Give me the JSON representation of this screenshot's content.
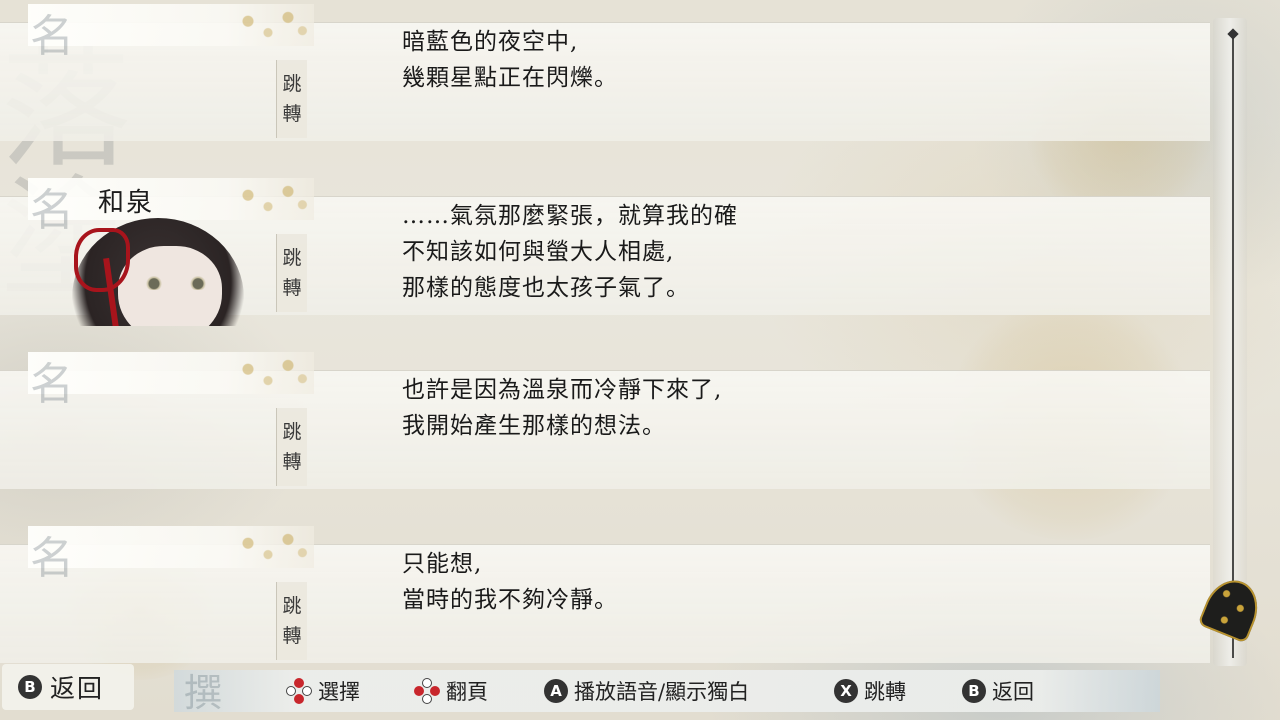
{
  "log_entries": [
    {
      "speaker": "",
      "name_ghost": "名",
      "jump_label": [
        "跳",
        "轉"
      ],
      "lines": [
        "暗藍色的夜空中,",
        "幾顆星點正在閃爍。"
      ]
    },
    {
      "speaker": "和泉",
      "name_ghost": "名",
      "jump_label": [
        "跳",
        "轉"
      ],
      "lines": [
        "……氣氛那麼緊張，就算我的確",
        "不知該如何與螢大人相處,",
        "那樣的態度也太孩子氣了。"
      ]
    },
    {
      "speaker": "",
      "name_ghost": "名",
      "jump_label": [
        "跳",
        "轉"
      ],
      "lines": [
        "也許是因為溫泉而冷靜下來了,",
        "我開始產生那樣的想法。"
      ]
    },
    {
      "speaker": "",
      "name_ghost": "名",
      "jump_label": [
        "跳",
        "轉"
      ],
      "lines": [
        "只能想,",
        "當時的我不夠冷靜。"
      ]
    }
  ],
  "back_button": {
    "key": "B",
    "label": "返回"
  },
  "hints_ghost": "撰",
  "hints": [
    {
      "icon": "dpad-up-down-icon",
      "label": "選擇"
    },
    {
      "icon": "dpad-left-right-icon",
      "label": "翻頁"
    },
    {
      "key": "A",
      "label": "播放語音/顯示獨白"
    },
    {
      "key": "X",
      "label": "跳轉"
    },
    {
      "key": "B",
      "label": "返回"
    }
  ],
  "background_glyphs": "落塗",
  "colors": {
    "accent_red": "#c8262c",
    "gold": "#c9a33a",
    "ink": "#1a1a1a"
  }
}
